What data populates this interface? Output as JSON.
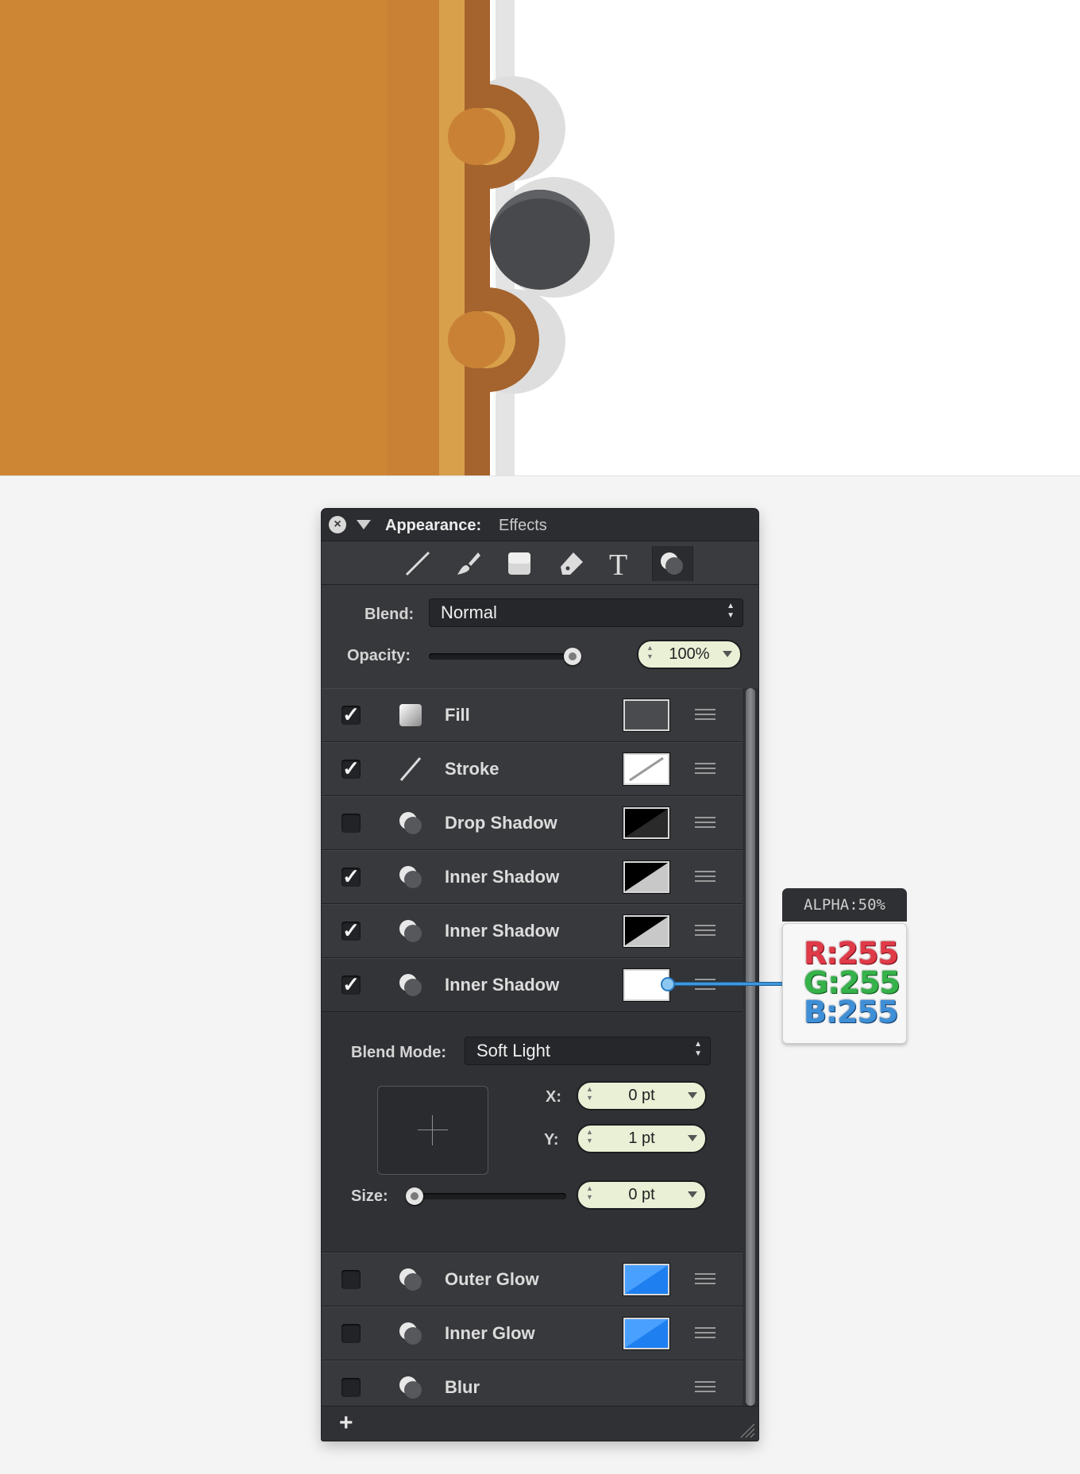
{
  "appearance": {
    "title_label": "Appearance:",
    "title_value": "Effects",
    "tools": [
      {
        "icon": "stroke-tool-icon"
      },
      {
        "icon": "brush-tool-icon"
      },
      {
        "icon": "fill-tool-icon"
      },
      {
        "icon": "eraser-tool-icon"
      },
      {
        "icon": "text-tool-icon",
        "glyph": "T"
      },
      {
        "icon": "effects-tool-icon",
        "active": true
      }
    ],
    "blend_label": "Blend:",
    "blend_value": "Normal",
    "opacity_label": "Opacity:",
    "opacity_value": "100%",
    "effects": [
      {
        "label": "Fill",
        "checked": true,
        "icon": "fill-icon",
        "swatch": "dark-gray"
      },
      {
        "label": "Stroke",
        "checked": true,
        "icon": "stroke-icon",
        "swatch": "white-slash"
      },
      {
        "label": "Drop Shadow",
        "checked": false,
        "icon": "effect-icon",
        "swatch": "black-white-diagonal"
      },
      {
        "label": "Inner Shadow",
        "checked": true,
        "icon": "effect-icon",
        "swatch": "black-gray-diagonal"
      },
      {
        "label": "Inner Shadow",
        "checked": true,
        "icon": "effect-icon",
        "swatch": "black-gray-diagonal"
      },
      {
        "label": "Inner Shadow",
        "checked": true,
        "icon": "effect-icon",
        "swatch": "white",
        "selected": true
      },
      {
        "label": "Outer Glow",
        "checked": false,
        "icon": "effect-icon",
        "swatch": "blue-diagonal"
      },
      {
        "label": "Inner Glow",
        "checked": false,
        "icon": "effect-icon",
        "swatch": "blue-diagonal"
      },
      {
        "label": "Blur",
        "checked": false,
        "icon": "effect-icon",
        "swatch": null
      }
    ],
    "detail": {
      "blend_mode_label": "Blend Mode:",
      "blend_mode_value": "Soft Light",
      "x_label": "X:",
      "x_value": "0 pt",
      "y_label": "Y:",
      "y_value": "1 pt",
      "size_label": "Size:",
      "size_value": "0 pt"
    },
    "add_label": "+"
  },
  "color_callout": {
    "alpha": "ALPHA:50%",
    "r": "R:255",
    "g": "G:255",
    "b": "B:255"
  },
  "colors": {
    "leather": "#cd8634",
    "leather_shade": "#c98235",
    "stitch_strip": "#d8a04a",
    "binding": "#a5632d",
    "shadow": "#dedede",
    "button": "#4e4f52",
    "panel": "#37383b",
    "accent_blue": "#3e97dc"
  }
}
